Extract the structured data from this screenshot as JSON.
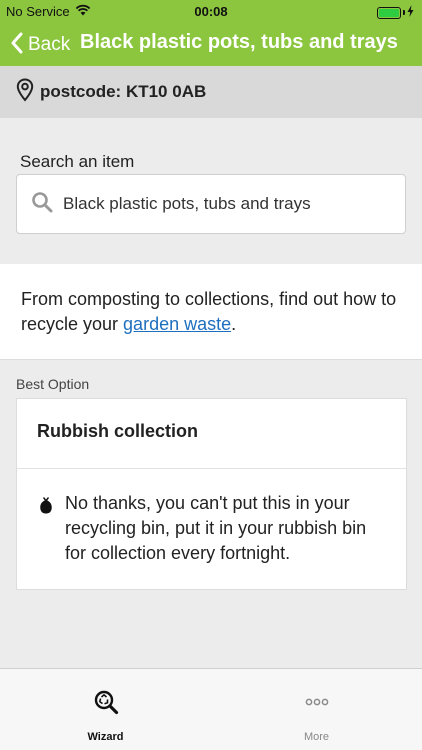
{
  "status_bar": {
    "carrier": "No Service",
    "time": "00:08"
  },
  "nav": {
    "back_label": "Back",
    "title": "Black plastic pots, tubs and trays"
  },
  "location": {
    "postcode_text": "postcode: KT10 0AB"
  },
  "search": {
    "label": "Search an item",
    "value": "Black plastic pots, tubs and trays"
  },
  "info": {
    "text_before": "From composting to collections, find out how to recycle your ",
    "link_text": "garden waste",
    "text_after": "."
  },
  "best_option": {
    "section_label": "Best Option",
    "title": "Rubbish collection",
    "description": "No thanks, you can't put this in your recycling bin, put it in your rubbish bin for collection every fortnight."
  },
  "tabs": [
    {
      "label": "Wizard",
      "icon": "recycle-search-icon",
      "active": true
    },
    {
      "label": "More",
      "icon": "more-dots-icon",
      "active": false
    }
  ],
  "colors": {
    "brand_green": "#8cc63f",
    "link_blue": "#1f6fbf"
  }
}
